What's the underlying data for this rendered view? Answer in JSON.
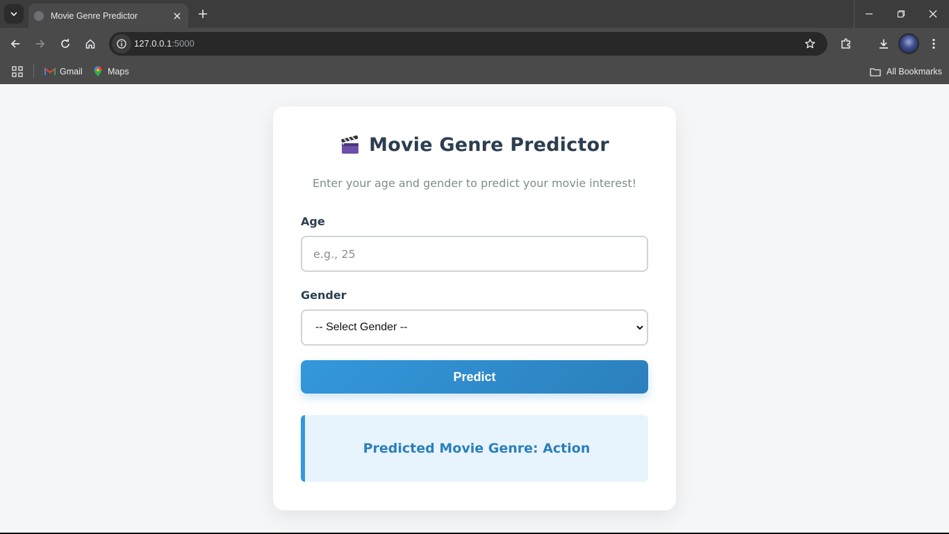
{
  "browser": {
    "tab_title": "Movie Genre Predictor",
    "url_host": "127.0.0.1",
    "url_port": ":5000",
    "bookmarks": [
      {
        "label": "Gmail",
        "icon": "gmail-icon"
      },
      {
        "label": "Maps",
        "icon": "maps-icon"
      }
    ],
    "all_bookmarks_label": "All Bookmarks"
  },
  "app": {
    "title": "Movie Genre Predictor",
    "title_icon": "clapperboard-icon",
    "subtitle": "Enter your age and gender to predict your movie interest!",
    "age": {
      "label": "Age",
      "placeholder": "e.g., 25",
      "value": ""
    },
    "gender": {
      "label": "Gender",
      "selected": "-- Select Gender --"
    },
    "predict_label": "Predict",
    "result_text": "Predicted Movie Genre: Action"
  },
  "colors": {
    "accent": "#3498db",
    "accent_dark": "#2b7fbc",
    "heading": "#2c3e50",
    "muted": "#7f8c8d",
    "result_bg": "#e8f4fd",
    "page_bg": "#f4f6f7"
  }
}
